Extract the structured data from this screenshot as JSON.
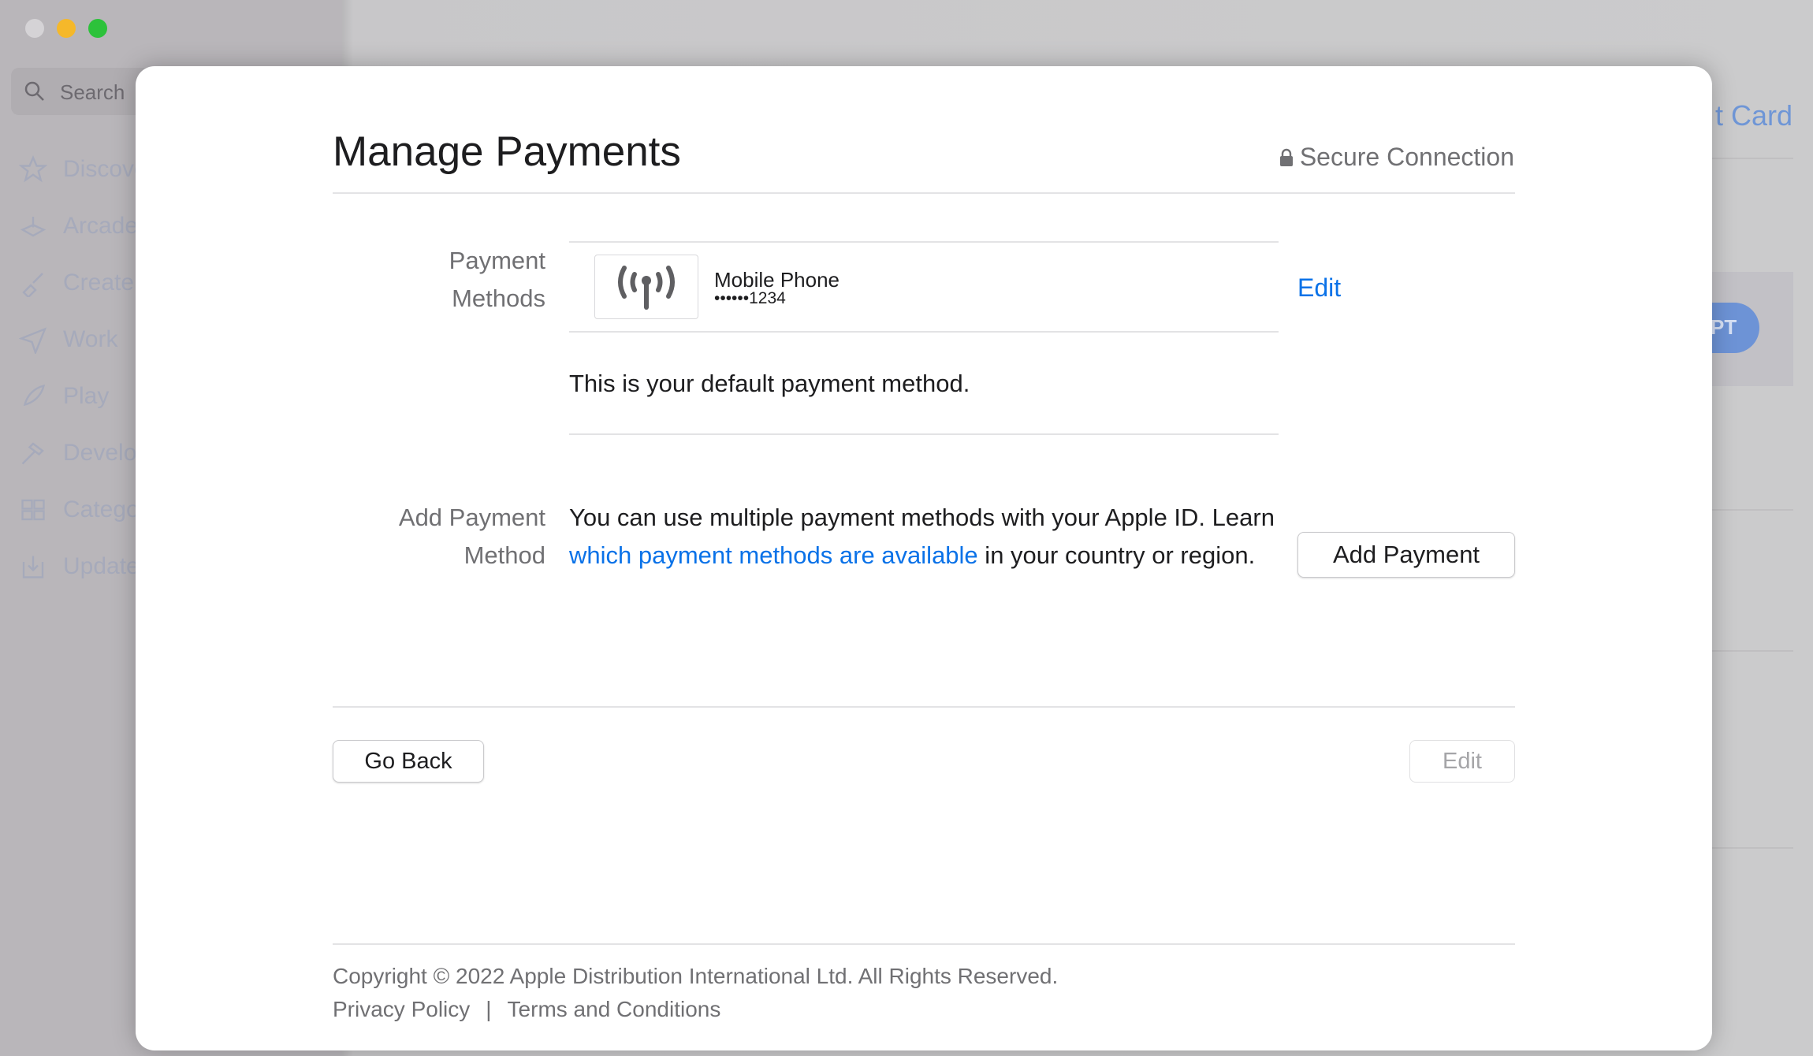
{
  "window": {
    "traffic_lights": {
      "close": "#d5d3d6",
      "minimize": "#f5b82a",
      "maximize": "#2dc23b"
    }
  },
  "sidebar": {
    "search_placeholder": "Search",
    "items": [
      {
        "label": "Discover",
        "icon": "star-icon"
      },
      {
        "label": "Arcade",
        "icon": "joystick-icon"
      },
      {
        "label": "Create",
        "icon": "paintbrush-icon"
      },
      {
        "label": "Work",
        "icon": "paperplane-icon"
      },
      {
        "label": "Play",
        "icon": "rocket-icon"
      },
      {
        "label": "Develop",
        "icon": "hammer-icon"
      },
      {
        "label": "Categories",
        "icon": "grid-icon"
      },
      {
        "label": "Updates",
        "icon": "download-icon"
      }
    ]
  },
  "background": {
    "title_fragment": "t Card",
    "pill_fragment": "PT"
  },
  "dialog": {
    "title": "Manage Payments",
    "secure": "Secure Connection",
    "payment_methods_label": [
      "Payment",
      "Methods"
    ],
    "method": {
      "name": "Mobile Phone",
      "number": "••••••1234",
      "icon": "antenna-icon"
    },
    "edit_link": "Edit",
    "default_note": "This is your default payment method.",
    "add_label": [
      "Add Payment",
      "Method"
    ],
    "add_text_1": "You can use multiple payment methods with your Apple ID. Learn ",
    "add_link": "which payment methods are available",
    "add_text_2": " in your country or region.",
    "add_button": "Add Payment",
    "go_back": "Go Back",
    "edit_button": "Edit",
    "copyright": "Copyright © 2022 Apple Distribution International Ltd. All Rights Reserved.",
    "privacy": "Privacy Policy",
    "separator": "|",
    "terms": "Terms and Conditions"
  },
  "colors": {
    "accent": "#0a72e8"
  }
}
